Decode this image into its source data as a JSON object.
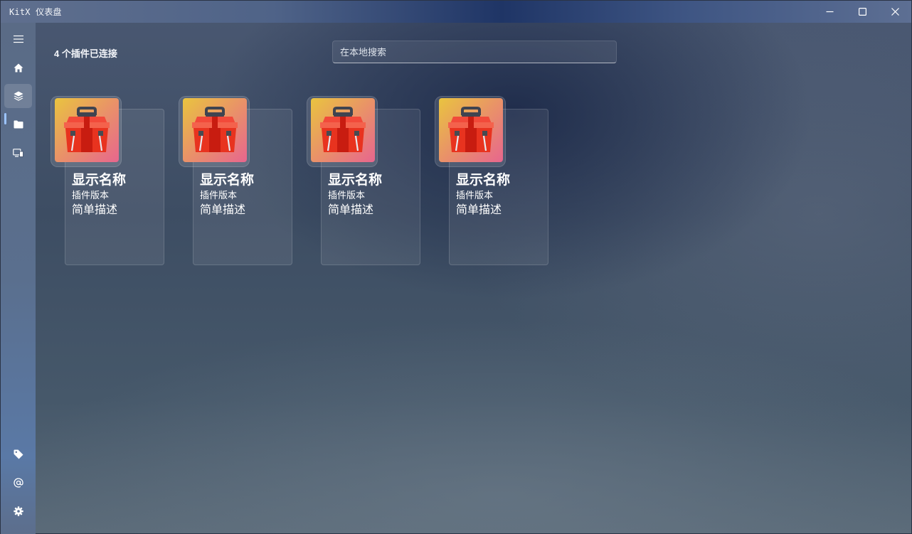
{
  "window": {
    "title": "KitX 仪表盘",
    "controls": {
      "minimize_icon": "minimize-icon",
      "maximize_icon": "maximize-icon",
      "close_icon": "close-icon"
    }
  },
  "sidebar": {
    "menu_icon": "hamburger-menu-icon",
    "items": [
      {
        "name": "home",
        "icon": "home-icon",
        "active": false
      },
      {
        "name": "plugins",
        "icon": "layers-icon",
        "active": true
      },
      {
        "name": "repository",
        "icon": "folder-icon",
        "active": false
      },
      {
        "name": "devices",
        "icon": "devices-icon",
        "active": false
      }
    ],
    "bottom_items": [
      {
        "name": "tags",
        "icon": "tag-icon"
      },
      {
        "name": "about",
        "icon": "at-icon"
      },
      {
        "name": "settings",
        "icon": "gear-icon"
      }
    ],
    "accent_color": "#9cc4ff"
  },
  "main": {
    "status": "4 个插件已连接",
    "search": {
      "placeholder": "在本地搜索",
      "value": ""
    },
    "plugins": [
      {
        "name": "显示名称",
        "version": "插件版本",
        "description": "简单描述",
        "icon": "toolbox-icon"
      },
      {
        "name": "显示名称",
        "version": "插件版本",
        "description": "简单描述",
        "icon": "toolbox-icon"
      },
      {
        "name": "显示名称",
        "version": "插件版本",
        "description": "简单描述",
        "icon": "toolbox-icon"
      },
      {
        "name": "显示名称",
        "version": "插件版本",
        "description": "简单描述",
        "icon": "toolbox-icon"
      }
    ]
  }
}
